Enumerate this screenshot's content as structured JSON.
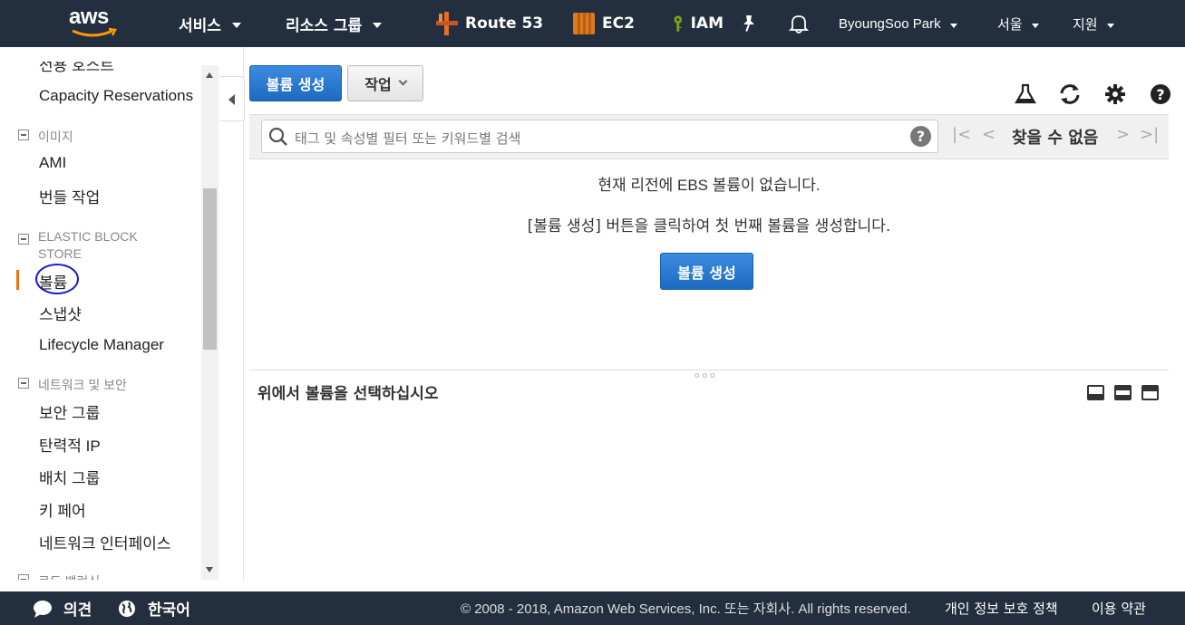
{
  "topnav": {
    "brand": "aws",
    "services": "서비스",
    "resource_groups": "리소스 그룹",
    "shortcuts": [
      {
        "label": "Route 53",
        "icon": "route53-icon"
      },
      {
        "label": "EC2",
        "icon": "ec2-icon"
      },
      {
        "label": "IAM",
        "icon": "iam-icon"
      }
    ],
    "user": "ByoungSoo Park",
    "region": "서울",
    "support": "지원",
    "colors": {
      "nav_bg": "#232f3e",
      "accent": "#ff9900",
      "primary": "#2d7dd2"
    }
  },
  "sidebar": {
    "cut_top": "전용 호스트",
    "capacity_reservations": "Capacity Reservations",
    "sections": [
      {
        "label": "이미지",
        "items": [
          "AMI",
          "번들 작업"
        ]
      },
      {
        "label": "ELASTIC BLOCK STORE",
        "label_line1": "ELASTIC BLOCK",
        "label_line2": "STORE",
        "items": [
          "볼륨",
          "스냅샷",
          "Lifecycle Manager"
        ]
      },
      {
        "label": "네트워크 및 보안",
        "items": [
          "보안 그룹",
          "탄력적 IP",
          "배치 그룹",
          "키 페어",
          "네트워크 인터페이스"
        ]
      },
      {
        "label": "로드 밸런싱"
      }
    ],
    "active_item": "볼륨"
  },
  "toolbar": {
    "create_volume": "볼륨 생성",
    "actions": "작업"
  },
  "filter": {
    "placeholder": "태그 및 속성별 필터 또는 키워드별 검색",
    "pager_text": "찾을 수 없음"
  },
  "empty_state": {
    "line1": "현재 리전에 EBS 볼륨이 없습니다.",
    "line2": "[볼륨 생성] 버튼을 클릭하여 첫 번째 볼륨을 생성합니다.",
    "button": "볼륨 생성"
  },
  "detail_panel": {
    "title": "위에서 볼륨을 선택하십시오"
  },
  "footer": {
    "feedback": "의견",
    "language": "한국어",
    "copyright": "© 2008 - 2018, Amazon Web Services, Inc. 또는 자회사. All rights reserved.",
    "privacy": "개인 정보 보호 정책",
    "terms": "이용 약관"
  }
}
